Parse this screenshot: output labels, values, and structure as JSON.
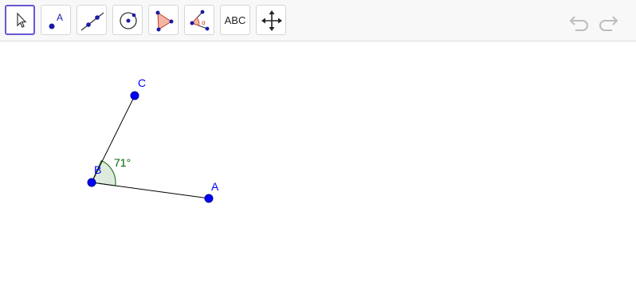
{
  "toolbar": {
    "tools": [
      {
        "name": "move-tool",
        "icon": "cursor-arrow-icon",
        "selected": true
      },
      {
        "name": "point-tool",
        "icon": "point-icon",
        "label": "A"
      },
      {
        "name": "line-tool",
        "icon": "line-icon"
      },
      {
        "name": "circle-tool",
        "icon": "circle-center-icon"
      },
      {
        "name": "polygon-tool",
        "icon": "polygon-icon"
      },
      {
        "name": "angle-tool",
        "icon": "angle-icon",
        "label": "α"
      },
      {
        "name": "text-tool",
        "icon": "text-icon",
        "label": "ABC"
      },
      {
        "name": "move-graphics-view-tool",
        "icon": "move-arrows-icon"
      }
    ],
    "undo_icon": "undo-icon",
    "redo_icon": "redo-icon"
  },
  "construction": {
    "points": [
      {
        "id": "A",
        "label": "A"
      },
      {
        "id": "B",
        "label": "B"
      },
      {
        "id": "C",
        "label": "C"
      }
    ],
    "angle": {
      "vertex": "B",
      "label": "71°",
      "value_deg": 71
    }
  },
  "colors": {
    "point": "#0000ff",
    "angle_fill": "#c8dcc8",
    "angle_stroke": "#006400",
    "selected_border": "#6557d2"
  }
}
